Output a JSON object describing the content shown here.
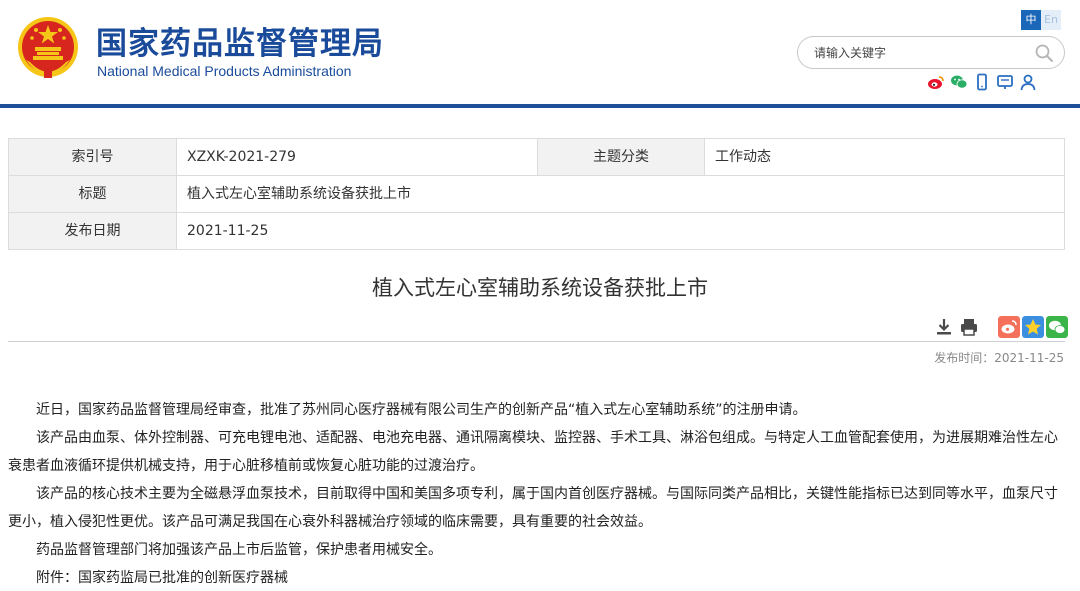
{
  "header": {
    "title": "国家药品监督管理局",
    "subtitle": "National Medical Products Administration",
    "lang_zh": "中",
    "lang_en": "En",
    "search_placeholder": "请输入关键字",
    "social_icons": [
      "weibo-icon",
      "wechat-icon",
      "mobile-icon",
      "message-icon",
      "user-icon"
    ]
  },
  "meta": {
    "index_label": "索引号",
    "index_value": "XZXK-2021-279",
    "category_label": "主题分类",
    "category_value": "工作动态",
    "title_label": "标题",
    "title_value": "植入式左心室辅助系统设备获批上市",
    "date_label": "发布日期",
    "date_value": "2021-11-25"
  },
  "article": {
    "title": "植入式左心室辅助系统设备获批上市",
    "publish_time": "发布时间：2021-11-25",
    "paragraphs": [
      "近日，国家药品监督管理局经审查，批准了苏州同心医疗器械有限公司生产的创新产品“植入式左心室辅助系统”的注册申请。",
      "该产品由血泵、体外控制器、可充电锂电池、适配器、电池充电器、通讯隔离模块、监控器、手术工具、淋浴包组成。与特定人工血管配套使用，为进展期难治性左心衰患者血液循环提供机械支持，用于心脏移植前或恢复心脏功能的过渡治疗。",
      "该产品的核心技术主要为全磁悬浮血泵技术，目前取得中国和美国多项专利，属于国内首创医疗器械。与国际同类产品相比，关键性能指标已达到同等水平，血泵尺寸更小，植入侵犯性更优。该产品可满足我国在心衰外科器械治疗领域的临床需要，具有重要的社会效益。",
      "药品监督管理部门将加强该产品上市后监管，保护患者用械安全。",
      "附件：国家药监局已批准的创新医疗器械"
    ],
    "tool_icons": [
      "download-icon",
      "print-icon",
      "share-weibo-icon",
      "share-qzone-icon",
      "share-wechat-icon"
    ]
  },
  "colors": {
    "brand_blue": "#1a4b9b",
    "header_rule": "#1f4f98",
    "emblem_red": "#d7261e",
    "emblem_gold": "#f5c518"
  }
}
